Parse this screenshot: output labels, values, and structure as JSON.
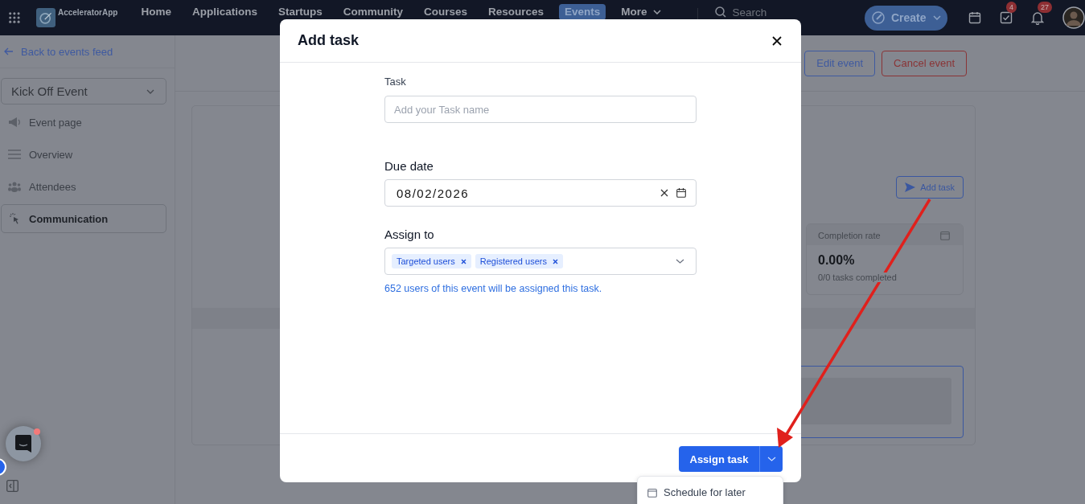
{
  "nav": {
    "brand": "AcceleratorApp",
    "items": [
      {
        "label": "Home",
        "selected": false
      },
      {
        "label": "Applications",
        "selected": false
      },
      {
        "label": "Startups",
        "selected": false
      },
      {
        "label": "Community",
        "selected": false
      },
      {
        "label": "Courses",
        "selected": false
      },
      {
        "label": "Resources",
        "selected": false
      },
      {
        "label": "Events",
        "selected": true
      },
      {
        "label": "More",
        "selected": false
      }
    ],
    "search": {
      "placeholder": "Search"
    },
    "create": "Create",
    "tools": [
      {
        "kind": "calendar"
      },
      {
        "kind": "tasks",
        "badge": "4"
      },
      {
        "kind": "bell",
        "badge": "27"
      }
    ]
  },
  "sidebar": {
    "back": "Back to events feed",
    "event": "Kick Off Event",
    "items": [
      {
        "label": "Event page",
        "kind": "megaphone",
        "selected": false
      },
      {
        "label": "Overview",
        "kind": "list",
        "selected": false
      },
      {
        "label": "Attendees",
        "kind": "people",
        "selected": false
      },
      {
        "label": "Communication",
        "kind": "pointer",
        "selected": true
      }
    ]
  },
  "actions": [
    {
      "label": "Edit event",
      "kind": "primary"
    },
    {
      "label": "Cancel event",
      "kind": "danger"
    }
  ],
  "panel": {
    "add_task": "Add task",
    "stat": {
      "title": "Completion rate",
      "value": "0.00%",
      "caption": "0/0 tasks completed"
    }
  },
  "modal": {
    "title": "Add task",
    "fields": [
      {
        "kind": "text",
        "label": "Task",
        "placeholder": "Add your Task name"
      },
      {
        "kind": "date",
        "label": "Due date",
        "value": "08/02/2026"
      },
      {
        "kind": "multiselect",
        "label": "Assign to",
        "chips": [
          "Targeted users",
          "Registered users"
        ],
        "help": "652 users of this event will be assigned this task."
      }
    ],
    "submit": "Assign task",
    "menu": [
      {
        "label": "Schedule for later"
      }
    ]
  },
  "chat": {
    "unread": true
  }
}
